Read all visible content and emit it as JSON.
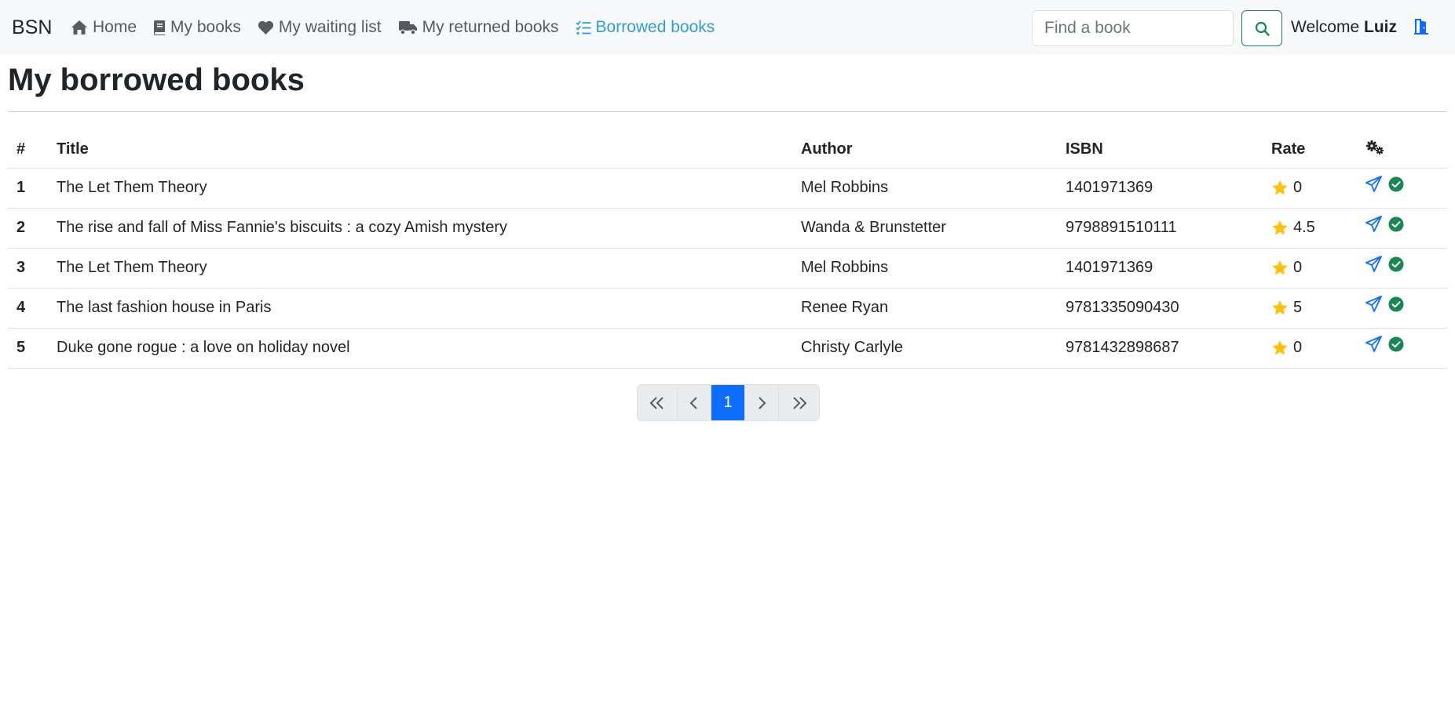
{
  "navbar": {
    "brand": "BSN",
    "items": [
      {
        "label": "Home",
        "icon": "house-icon",
        "active": false
      },
      {
        "label": "My books",
        "icon": "book-icon",
        "active": false
      },
      {
        "label": "My waiting list",
        "icon": "heart-icon",
        "active": false
      },
      {
        "label": "My returned books",
        "icon": "truck-icon",
        "active": false
      },
      {
        "label": "Borrowed books",
        "icon": "list-check-icon",
        "active": true
      }
    ],
    "search": {
      "placeholder": "Find a book",
      "value": ""
    },
    "welcome_label": "Welcome",
    "username": "Luiz",
    "colors": {
      "active": "#2d9fd6",
      "search_button": "#198754",
      "logout": "#0d6efd"
    }
  },
  "page": {
    "title": "My borrowed books"
  },
  "table": {
    "headers": [
      "#",
      "Title",
      "Author",
      "ISBN",
      "Rate"
    ],
    "actions_header_icon": "gears-icon",
    "rows": [
      {
        "index": "1",
        "title": "The Let Them Theory",
        "author": "Mel Robbins",
        "isbn": "1401971369",
        "rate": "0"
      },
      {
        "index": "2",
        "title": "The rise and fall of Miss Fannie's biscuits : a cozy Amish mystery",
        "author": "Wanda & Brunstetter",
        "isbn": "9798891510111",
        "rate": "4.5"
      },
      {
        "index": "3",
        "title": "The Let Them Theory",
        "author": "Mel Robbins",
        "isbn": "1401971369",
        "rate": "0"
      },
      {
        "index": "4",
        "title": "The last fashion house in Paris",
        "author": "Renee Ryan",
        "isbn": "9781335090430",
        "rate": "5"
      },
      {
        "index": "5",
        "title": "Duke gone rogue : a love on holiday novel",
        "author": "Christy Carlyle",
        "isbn": "9781432898687",
        "rate": "0"
      }
    ],
    "row_action_icons": [
      "paper-plane-icon",
      "check-circle-icon"
    ],
    "colors": {
      "star": "#ffc107",
      "share": "#0d6efd",
      "approved": "#198754"
    }
  },
  "pagination": {
    "current_page": "1",
    "controls": [
      "first-page-icon",
      "previous-page-icon",
      "next-page-icon",
      "last-page-icon"
    ],
    "colors": {
      "active": "#0d6efd"
    }
  }
}
